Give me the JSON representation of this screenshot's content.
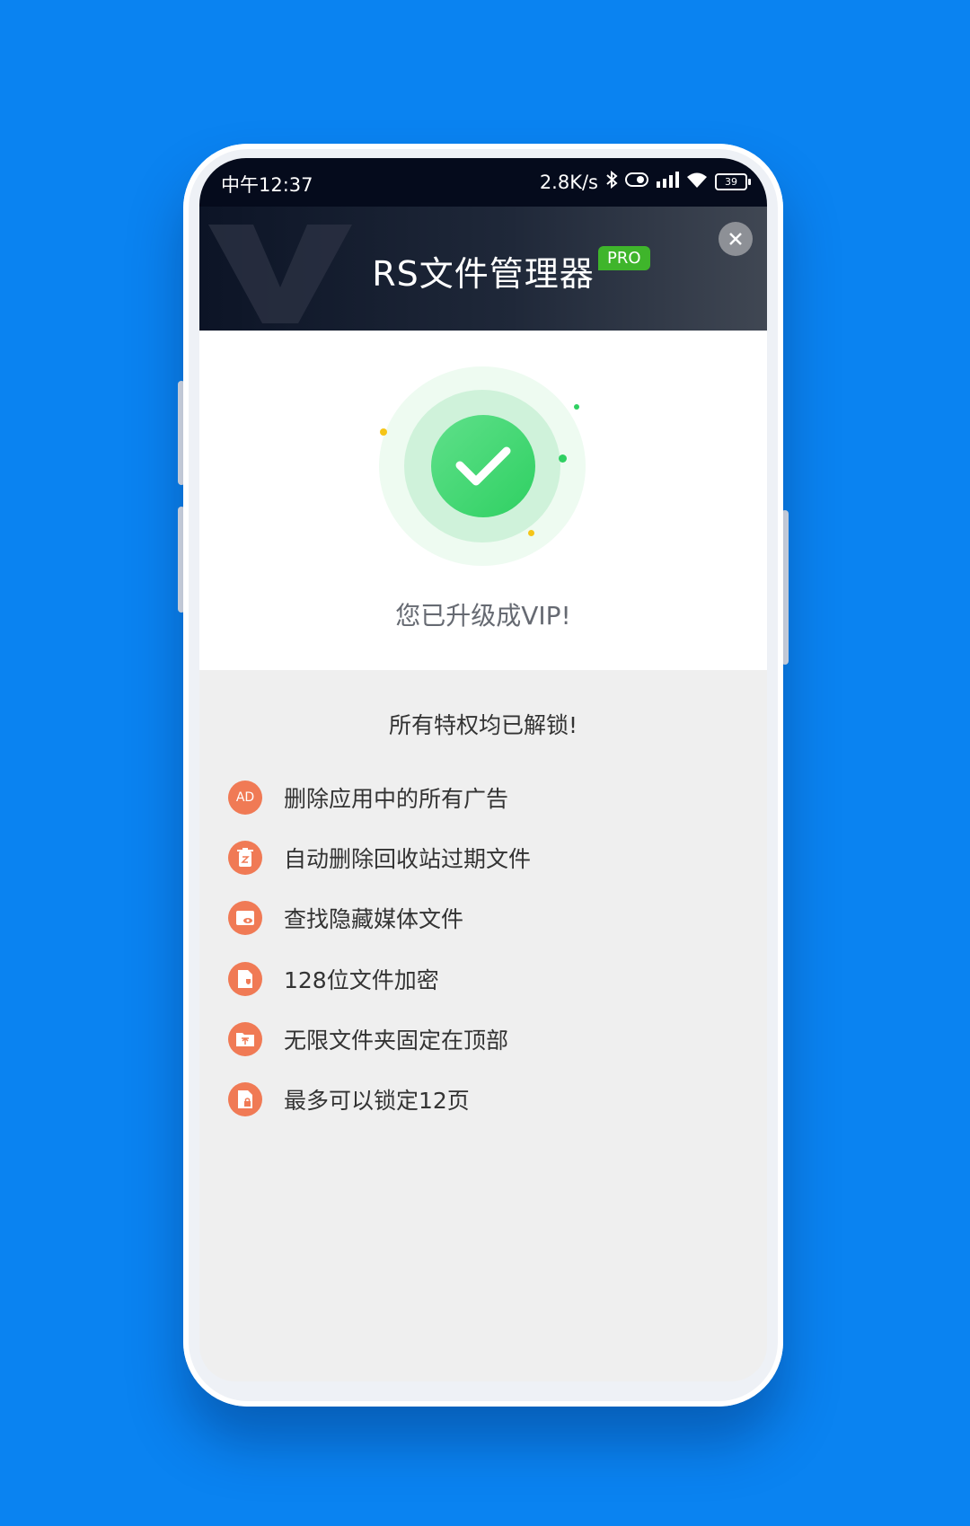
{
  "status_bar": {
    "time": "中午12:37",
    "speed": "2.8K/s",
    "battery": "39"
  },
  "banner": {
    "title": "RS文件管理器",
    "badge": "PRO"
  },
  "hero": {
    "message": "您已升级成VIP!"
  },
  "features": {
    "title": "所有特权均已解锁!",
    "items": [
      {
        "label": "删除应用中的所有广告",
        "icon": "ad-icon",
        "glyph": "AD"
      },
      {
        "label": "自动删除回收站过期文件",
        "icon": "recycle-bin-icon",
        "glyph": ""
      },
      {
        "label": "查找隐藏媒体文件",
        "icon": "hidden-media-icon",
        "glyph": ""
      },
      {
        "label": "128位文件加密",
        "icon": "encrypted-file-icon",
        "glyph": ""
      },
      {
        "label": "无限文件夹固定在顶部",
        "icon": "pin-folder-icon",
        "glyph": ""
      },
      {
        "label": "最多可以锁定12页",
        "icon": "lock-page-icon",
        "glyph": ""
      }
    ]
  },
  "colors": {
    "background": "#0a83f1",
    "accent_green": "#2fd062",
    "feature_icon": "#f07a55",
    "pro_badge": "#3fb52b"
  }
}
